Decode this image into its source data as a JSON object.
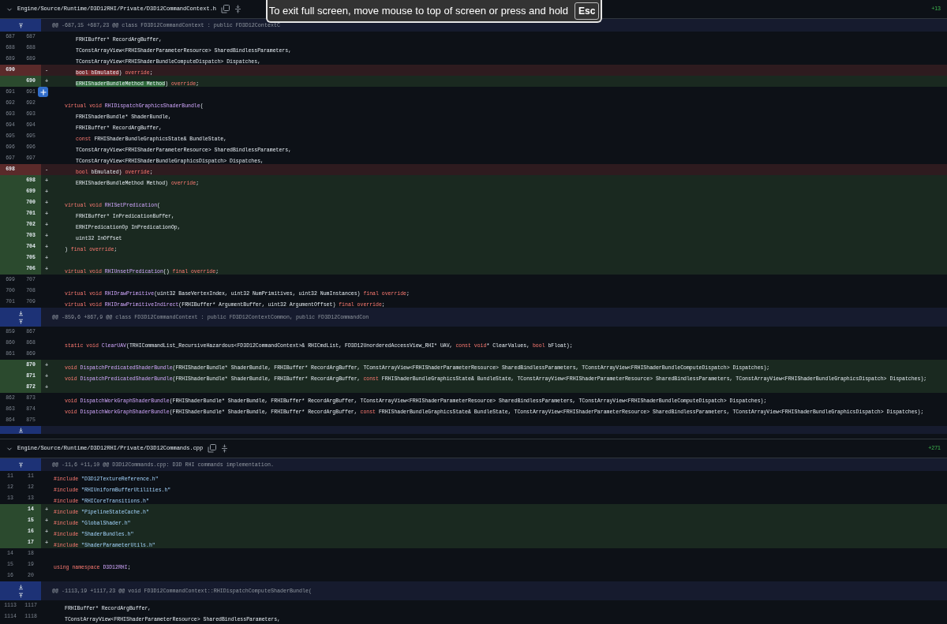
{
  "fullscreen_notice": {
    "text": "To exit full screen, move mouse to top of screen or press and hold",
    "key": "Esc"
  },
  "files": [
    {
      "path": "Engine/Source/Runtime/D3D12RHI/Private/D3D12CommandContext.h",
      "expanded": true,
      "additions": "+13",
      "lines": [
        {
          "kind": "hunk",
          "expand_up": true,
          "expand_down": false,
          "text": "@@ -687,15 +687,23 @@ class FD3D12CommandContext : public FD3D12ContextC"
        },
        {
          "kind": "context",
          "old": "687",
          "new": "687",
          "indented": true,
          "double_indented": true,
          "code": [
            {
              "kind": "plain",
              "text": "FRHIBuffer* RecordArgBuffer,"
            }
          ]
        },
        {
          "kind": "context",
          "old": "688",
          "new": "688",
          "indented": true,
          "double_indented": true,
          "code": [
            {
              "kind": "plain",
              "text": "TConstArrayView<FRHIShaderParameterResource> SharedBindlessParameters,"
            }
          ]
        },
        {
          "kind": "context",
          "old": "689",
          "new": "689",
          "indented": true,
          "double_indented": true,
          "code": [
            {
              "kind": "plain",
              "text": "TConstArrayView<FRHIShaderBundleComputeDispatch> Dispatches,"
            }
          ]
        },
        {
          "kind": "del",
          "old": "690",
          "marker": "-",
          "indented": true,
          "double_indented": true,
          "code": [
            {
              "kind": "removed_word",
              "text": "bool bEmulated"
            },
            {
              "kind": "plain",
              "text": ") "
            },
            {
              "kind": "keyword",
              "text": "override"
            },
            {
              "kind": "plain",
              "text": ";"
            }
          ]
        },
        {
          "kind": "add",
          "new": "690",
          "marker": "+",
          "indented": true,
          "double_indented": true,
          "code": [
            {
              "kind": "added_word",
              "text": "ERHIShaderBundleMethod Method"
            },
            {
              "kind": "plain",
              "text": ") "
            },
            {
              "kind": "keyword",
              "text": "override"
            },
            {
              "kind": "plain",
              "text": ";"
            }
          ]
        },
        {
          "kind": "context",
          "old": "691",
          "new": "691",
          "hovered": true
        },
        {
          "kind": "context",
          "old": "692",
          "new": "692",
          "indented": true,
          "double_indented": false,
          "code": [
            {
              "kind": "keyword",
              "text": "virtual void "
            },
            {
              "kind": "function",
              "text": "RHIDispatchGraphicsShaderBundle"
            },
            {
              "kind": "plain",
              "text": "("
            }
          ]
        },
        {
          "kind": "context",
          "old": "693",
          "new": "693",
          "indented": true,
          "double_indented": true,
          "code": [
            {
              "kind": "plain",
              "text": "FRHIShaderBundle* ShaderBundle,"
            }
          ]
        },
        {
          "kind": "context",
          "old": "694",
          "new": "694",
          "indented": true,
          "double_indented": true,
          "code": [
            {
              "kind": "plain",
              "text": "FRHIBuffer* RecordArgBuffer,"
            }
          ]
        },
        {
          "kind": "context",
          "old": "695",
          "new": "695",
          "indented": true,
          "double_indented": true,
          "code": [
            {
              "kind": "keyword",
              "text": "const "
            },
            {
              "kind": "plain",
              "text": "FRHIShaderBundleGraphicsState& BundleState,"
            }
          ]
        },
        {
          "kind": "context",
          "old": "696",
          "new": "696",
          "indented": true,
          "double_indented": true,
          "code": [
            {
              "kind": "plain",
              "text": "TConstArrayView<FRHIShaderParameterResource> SharedBindlessParameters,"
            }
          ]
        },
        {
          "kind": "context",
          "old": "697",
          "new": "697",
          "indented": true,
          "double_indented": true,
          "code": [
            {
              "kind": "plain",
              "text": "TConstArrayView<FRHIShaderBundleGraphicsDispatch> Dispatches,"
            }
          ]
        },
        {
          "kind": "del",
          "old": "698",
          "marker": "-",
          "indented": true,
          "double_indented": true,
          "code": [
            {
              "kind": "keyword",
              "text": "bool "
            },
            {
              "kind": "plain",
              "text": "bEmulated) "
            },
            {
              "kind": "keyword",
              "text": "override"
            },
            {
              "kind": "plain",
              "text": ";"
            }
          ]
        },
        {
          "kind": "add",
          "new": "698",
          "marker": "+",
          "indented": true,
          "double_indented": true,
          "code": [
            {
              "kind": "plain",
              "text": "ERHIShaderBundleMethod Method) "
            },
            {
              "kind": "keyword",
              "text": "override"
            },
            {
              "kind": "plain",
              "text": ";"
            }
          ]
        },
        {
          "kind": "add",
          "new": "699",
          "marker": "+"
        },
        {
          "kind": "add",
          "new": "700",
          "marker": "+",
          "indented": true,
          "double_indented": false,
          "code": [
            {
              "kind": "keyword",
              "text": "virtual void "
            },
            {
              "kind": "function",
              "text": "RHISetPredication"
            },
            {
              "kind": "plain",
              "text": "("
            }
          ]
        },
        {
          "kind": "add",
          "new": "701",
          "marker": "+",
          "indented": true,
          "double_indented": true,
          "code": [
            {
              "kind": "plain",
              "text": "FRHIBuffer* InPredicationBuffer,"
            }
          ]
        },
        {
          "kind": "add",
          "new": "702",
          "marker": "+",
          "indented": true,
          "double_indented": true,
          "code": [
            {
              "kind": "plain",
              "text": "ERHIPredicationOp InPredicationOp,"
            }
          ]
        },
        {
          "kind": "add",
          "new": "703",
          "marker": "+",
          "indented": true,
          "double_indented": true,
          "code": [
            {
              "kind": "plain",
              "text": "uint32 InOffset"
            }
          ]
        },
        {
          "kind": "add",
          "new": "704",
          "marker": "+",
          "indented": true,
          "double_indented": false,
          "code": [
            {
              "kind": "plain",
              "text": ") "
            },
            {
              "kind": "keyword",
              "text": "final override"
            },
            {
              "kind": "plain",
              "text": ";"
            }
          ]
        },
        {
          "kind": "add",
          "new": "705",
          "marker": "+"
        },
        {
          "kind": "add",
          "new": "706",
          "marker": "+",
          "indented": true,
          "double_indented": false,
          "code": [
            {
              "kind": "keyword",
              "text": "virtual void "
            },
            {
              "kind": "function",
              "text": "RHIUnsetPredication"
            },
            {
              "kind": "plain",
              "text": "() "
            },
            {
              "kind": "keyword",
              "text": "final override"
            },
            {
              "kind": "plain",
              "text": ";"
            }
          ]
        },
        {
          "kind": "context",
          "old": "699",
          "new": "707"
        },
        {
          "kind": "context",
          "old": "700",
          "new": "708",
          "indented": true,
          "double_indented": false,
          "code": [
            {
              "kind": "keyword",
              "text": "virtual void "
            },
            {
              "kind": "function",
              "text": "RHIDrawPrimitive"
            },
            {
              "kind": "plain",
              "text": "(uint32 BaseVertexIndex, uint32 NumPrimitives, uint32 NumInstances) "
            },
            {
              "kind": "keyword",
              "text": "final override"
            },
            {
              "kind": "plain",
              "text": ";"
            }
          ]
        },
        {
          "kind": "context",
          "old": "701",
          "new": "709",
          "indented": true,
          "double_indented": false,
          "code": [
            {
              "kind": "keyword",
              "text": "virtual void "
            },
            {
              "kind": "function",
              "text": "RHIDrawPrimitiveIndirect"
            },
            {
              "kind": "plain",
              "text": "(FRHIBuffer* ArgumentBuffer, uint32 ArgumentOffset) "
            },
            {
              "kind": "keyword",
              "text": "final override"
            },
            {
              "kind": "plain",
              "text": ";"
            }
          ]
        },
        {
          "kind": "hunk",
          "expand_up": true,
          "expand_down": true,
          "text": "@@ -859,6 +867,9 @@ class FD3D12CommandContext : public FD3D12ContextCommon, public FD3D12CommandCon"
        },
        {
          "kind": "context",
          "old": "859",
          "new": "867"
        },
        {
          "kind": "context",
          "old": "860",
          "new": "868",
          "indented": true,
          "double_indented": false,
          "code": [
            {
              "kind": "keyword",
              "text": "static void "
            },
            {
              "kind": "function",
              "text": "ClearUAV"
            },
            {
              "kind": "plain",
              "text": "(TRHICommandList_RecursiveHazardous<FD3D12CommandContext>& RHICmdList, FD3D12UnorderedAccessView_RHI* UAV, "
            },
            {
              "kind": "keyword",
              "text": "const void"
            },
            {
              "kind": "plain",
              "text": "* ClearValues, "
            },
            {
              "kind": "keyword",
              "text": "bool "
            },
            {
              "kind": "plain",
              "text": "bFloat);"
            }
          ]
        },
        {
          "kind": "context",
          "old": "861",
          "new": "869"
        },
        {
          "kind": "add",
          "new": "870",
          "marker": "+",
          "indented": true,
          "double_indented": false,
          "code": [
            {
              "kind": "keyword",
              "text": "void "
            },
            {
              "kind": "function",
              "text": "DispatchPredicatedShaderBundle"
            },
            {
              "kind": "plain",
              "text": "(FRHIShaderBundle* ShaderBundle, FRHIBuffer* RecordArgBuffer, TConstArrayView<FRHIShaderParameterResource> SharedBindlessParameters, TConstArrayView<FRHIShaderBundleComputeDispatch> Dispatches);"
            }
          ]
        },
        {
          "kind": "add",
          "new": "871",
          "marker": "+",
          "indented": true,
          "double_indented": false,
          "code": [
            {
              "kind": "keyword",
              "text": "void "
            },
            {
              "kind": "function",
              "text": "DispatchPredicatedShaderBundle"
            },
            {
              "kind": "plain",
              "text": "(FRHIShaderBundle* ShaderBundle, FRHIBuffer* RecordArgBuffer, "
            },
            {
              "kind": "keyword",
              "text": "const "
            },
            {
              "kind": "plain",
              "text": "FRHIShaderBundleGraphicsState& BundleState, TConstArrayView<FRHIShaderParameterResource> SharedBindlessParameters, TConstArrayView<FRHIShaderBundleGraphicsDispatch> Dispatches);"
            }
          ]
        },
        {
          "kind": "add",
          "new": "872",
          "marker": "+"
        },
        {
          "kind": "context",
          "old": "862",
          "new": "873",
          "indented": true,
          "double_indented": false,
          "code": [
            {
              "kind": "keyword",
              "text": "void "
            },
            {
              "kind": "function",
              "text": "DispatchWorkGraphShaderBundle"
            },
            {
              "kind": "plain",
              "text": "(FRHIShaderBundle* ShaderBundle, FRHIBuffer* RecordArgBuffer, TConstArrayView<FRHIShaderParameterResource> SharedBindlessParameters, TConstArrayView<FRHIShaderBundleComputeDispatch> Dispatches);"
            }
          ]
        },
        {
          "kind": "context",
          "old": "863",
          "new": "874",
          "indented": true,
          "double_indented": false,
          "code": [
            {
              "kind": "keyword",
              "text": "void "
            },
            {
              "kind": "function",
              "text": "DispatchWorkGraphShaderBundle"
            },
            {
              "kind": "plain",
              "text": "(FRHIShaderBundle* ShaderBundle, FRHIBuffer* RecordArgBuffer, "
            },
            {
              "kind": "keyword",
              "text": "const "
            },
            {
              "kind": "plain",
              "text": "FRHIShaderBundleGraphicsState& BundleState, TConstArrayView<FRHIShaderParameterResource> SharedBindlessParameters, TConstArrayView<FRHIShaderBundleGraphicsDispatch> Dispatches);"
            }
          ]
        },
        {
          "kind": "context",
          "old": "864",
          "new": "875"
        },
        {
          "kind": "hunk",
          "expand_up": false,
          "expand_down": true
        }
      ]
    },
    {
      "path": "Engine/Source/Runtime/D3D12RHI/Private/D3D12Commands.cpp",
      "expanded": true,
      "additions": "+271",
      "lines": [
        {
          "kind": "hunk",
          "expand_up": true,
          "expand_down": false,
          "text": "@@ -11,6 +11,10 @@ D3D12Commands.cpp: D3D RHI commands implementation."
        },
        {
          "kind": "context",
          "old": "11",
          "new": "11",
          "indented": false,
          "double_indented": false,
          "code": [
            {
              "kind": "keyword",
              "text": "#include "
            },
            {
              "kind": "string",
              "text": "\"D3D12TextureReference.h\""
            }
          ]
        },
        {
          "kind": "context",
          "old": "12",
          "new": "12",
          "indented": false,
          "double_indented": false,
          "code": [
            {
              "kind": "keyword",
              "text": "#include "
            },
            {
              "kind": "string",
              "text": "\"RHIUniformBufferUtilities.h\""
            }
          ]
        },
        {
          "kind": "context",
          "old": "13",
          "new": "13",
          "indented": false,
          "double_indented": false,
          "code": [
            {
              "kind": "keyword",
              "text": "#include "
            },
            {
              "kind": "string",
              "text": "\"RHICoreTransitions.h\""
            }
          ]
        },
        {
          "kind": "add",
          "new": "14",
          "marker": "+",
          "indented": false,
          "double_indented": false,
          "code": [
            {
              "kind": "keyword",
              "text": "#include "
            },
            {
              "kind": "string",
              "text": "\"PipelineStateCache.h\""
            }
          ]
        },
        {
          "kind": "add",
          "new": "15",
          "marker": "+",
          "indented": false,
          "double_indented": false,
          "code": [
            {
              "kind": "keyword",
              "text": "#include "
            },
            {
              "kind": "string",
              "text": "\"GlobalShader.h\""
            }
          ]
        },
        {
          "kind": "add",
          "new": "16",
          "marker": "+",
          "indented": false,
          "double_indented": false,
          "code": [
            {
              "kind": "keyword",
              "text": "#include "
            },
            {
              "kind": "string",
              "text": "\"ShaderBundles.h\""
            }
          ]
        },
        {
          "kind": "add",
          "new": "17",
          "marker": "+",
          "indented": false,
          "double_indented": false,
          "code": [
            {
              "kind": "keyword",
              "text": "#include "
            },
            {
              "kind": "string",
              "text": "\"ShaderParameterUtils.h\""
            }
          ]
        },
        {
          "kind": "context",
          "old": "14",
          "new": "18"
        },
        {
          "kind": "context",
          "old": "15",
          "new": "19",
          "indented": false,
          "double_indented": false,
          "code": [
            {
              "kind": "keyword",
              "text": "using namespace "
            },
            {
              "kind": "function",
              "text": "D3D12RHI"
            },
            {
              "kind": "plain",
              "text": ";"
            }
          ]
        },
        {
          "kind": "context",
          "old": "16",
          "new": "20"
        },
        {
          "kind": "hunk",
          "expand_up": true,
          "expand_down": true,
          "text": "@@ -1113,19 +1117,23 @@ void FD3D12CommandContext::RHIDispatchComputeShaderBundle("
        },
        {
          "kind": "context",
          "old": "1113",
          "new": "1117",
          "indented": true,
          "double_indented": false,
          "code": [
            {
              "kind": "plain",
              "text": "FRHIBuffer* RecordArgBuffer,"
            }
          ]
        },
        {
          "kind": "context",
          "old": "1114",
          "new": "1118",
          "indented": true,
          "double_indented": false,
          "code": [
            {
              "kind": "plain",
              "text": "TConstArrayView<FRHIShaderParameterResource> SharedBindlessParameters,"
            }
          ]
        }
      ]
    }
  ]
}
